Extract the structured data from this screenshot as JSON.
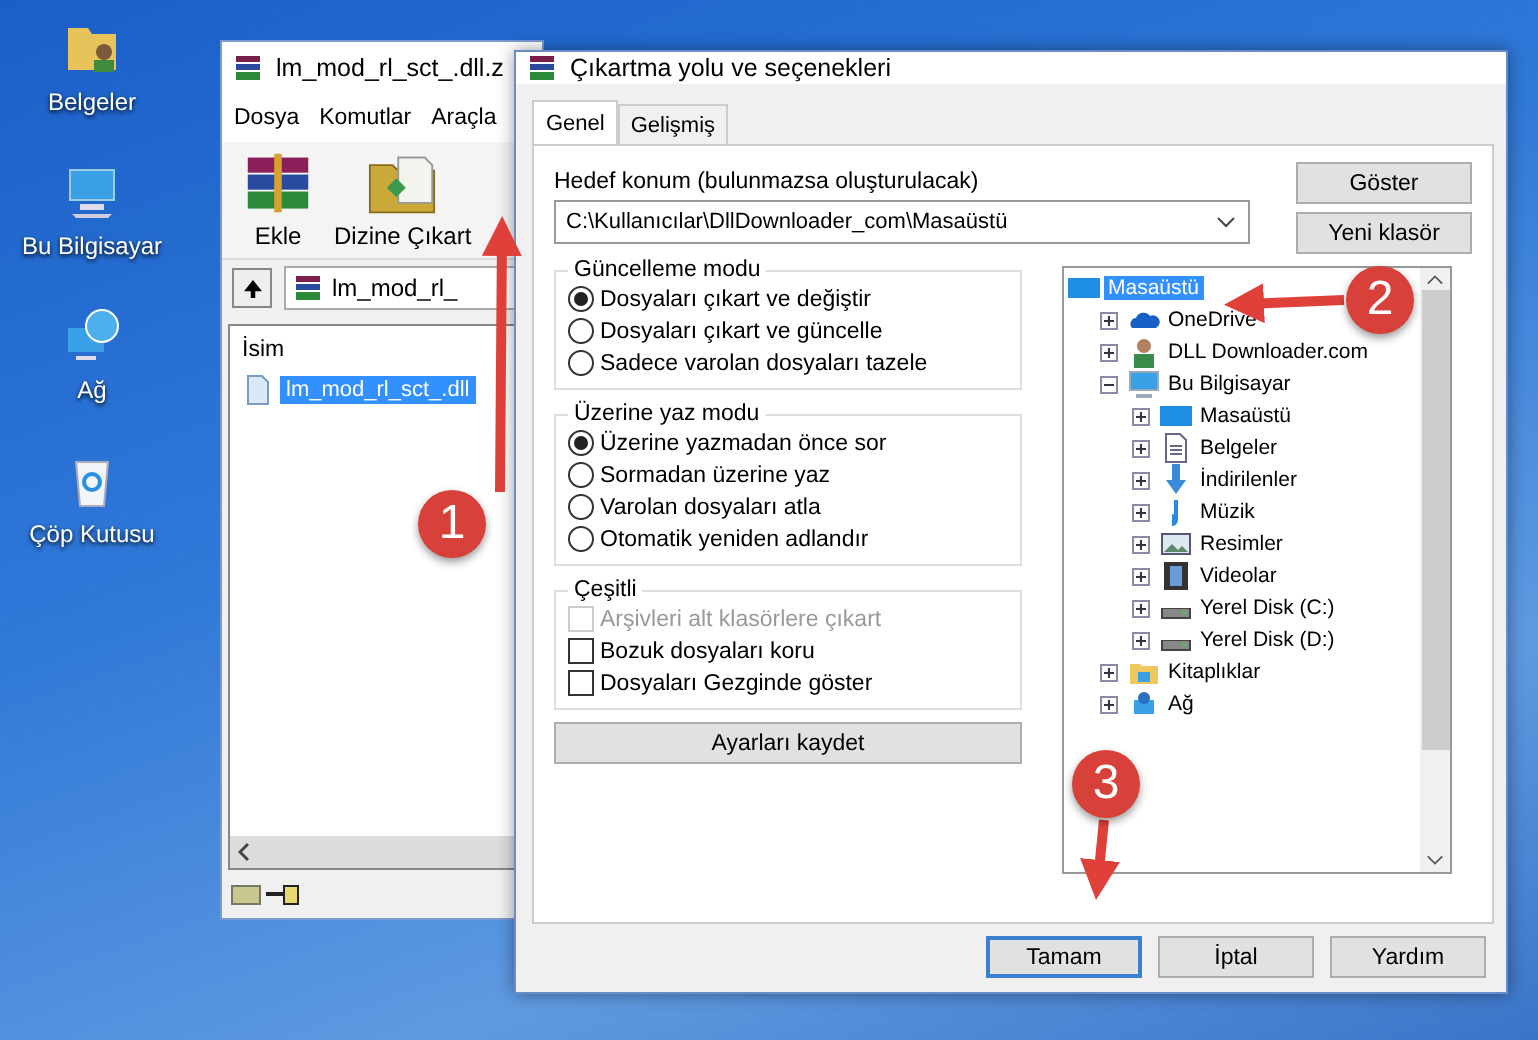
{
  "desktop_icons": [
    {
      "kind": "documents",
      "label": "Belgeler"
    },
    {
      "kind": "computer",
      "label": "Bu Bilgisayar"
    },
    {
      "kind": "network",
      "label": "Ağ"
    },
    {
      "kind": "recycle",
      "label": "Çöp Kutusu"
    }
  ],
  "archive_window": {
    "title": "lm_mod_rl_sct_.dll.z",
    "menu": [
      "Dosya",
      "Komutlar",
      "Araçla"
    ],
    "toolbar": [
      {
        "kind": "add",
        "label": "Ekle"
      },
      {
        "kind": "extract",
        "label": "Dizine Çıkart"
      }
    ],
    "address": "lm_mod_rl_",
    "column": "İsim",
    "files": [
      {
        "name": "lm_mod_rl_sct_.dll",
        "selected": true
      }
    ]
  },
  "dialog": {
    "title": "Çıkartma yolu ve seçenekleri",
    "tabs": [
      {
        "label": "Genel",
        "selected": true
      },
      {
        "label": "Gelişmiş",
        "selected": false
      }
    ],
    "destination_label": "Hedef konum (bulunmazsa oluşturulacak)",
    "destination_value": "C:\\Kullanıcılar\\DllDownloader_com\\Masaüstü",
    "side_buttons": [
      "Göster",
      "Yeni klasör"
    ],
    "update_mode": {
      "title": "Güncelleme modu",
      "options": [
        {
          "label": "Dosyaları çıkart ve değiştir",
          "selected": true
        },
        {
          "label": "Dosyaları çıkart ve güncelle",
          "selected": false
        },
        {
          "label": "Sadece varolan dosyaları tazele",
          "selected": false
        }
      ]
    },
    "overwrite_mode": {
      "title": "Üzerine yaz modu",
      "options": [
        {
          "label": "Üzerine yazmadan önce sor",
          "selected": true
        },
        {
          "label": "Sormadan üzerine yaz",
          "selected": false
        },
        {
          "label": "Varolan dosyaları atla",
          "selected": false
        },
        {
          "label": "Otomatik yeniden adlandır",
          "selected": false
        }
      ]
    },
    "misc": {
      "title": "Çeşitli",
      "options": [
        {
          "label": "Arşivleri alt klasörlere çıkart",
          "checked": false,
          "disabled": true
        },
        {
          "label": "Bozuk dosyaları koru",
          "checked": false,
          "disabled": false
        },
        {
          "label": "Dosyaları Gezginde göster",
          "checked": false,
          "disabled": false
        }
      ]
    },
    "save_button": "Ayarları kaydet",
    "tree": [
      {
        "kind": "desktop",
        "label": "Masaüstü",
        "selected": true,
        "children": [
          {
            "kind": "cloud",
            "label": "OneDrive",
            "selected": false,
            "expanded": false
          },
          {
            "kind": "user",
            "label": "DLL Downloader.com",
            "selected": false,
            "expanded": false
          },
          {
            "kind": "computer",
            "label": "Bu Bilgisayar",
            "selected": false,
            "expanded": true,
            "children": [
              {
                "kind": "desktop",
                "label": "Masaüstü",
                "selected": false,
                "expanded": false
              },
              {
                "kind": "document",
                "label": "Belgeler",
                "selected": false,
                "expanded": false
              },
              {
                "kind": "download",
                "label": "İndirilenler",
                "selected": false,
                "expanded": false
              },
              {
                "kind": "music",
                "label": "Müzik",
                "selected": false,
                "expanded": false
              },
              {
                "kind": "pictures",
                "label": "Resimler",
                "selected": false,
                "expanded": false
              },
              {
                "kind": "videos",
                "label": "Videolar",
                "selected": false,
                "expanded": false
              },
              {
                "kind": "drive",
                "label": "Yerel Disk (C:)",
                "selected": false,
                "expanded": false
              },
              {
                "kind": "drive",
                "label": "Yerel Disk (D:)",
                "selected": false,
                "expanded": false
              }
            ]
          },
          {
            "kind": "library",
            "label": "Kitaplıklar",
            "selected": false,
            "expanded": false
          },
          {
            "kind": "network",
            "label": "Ağ",
            "selected": false,
            "expanded": false
          }
        ]
      }
    ],
    "buttons": [
      {
        "label": "Tamam",
        "default": true
      },
      {
        "label": "İptal",
        "default": false
      },
      {
        "label": "Yardım",
        "default": false
      }
    ]
  },
  "annotations": [
    "1",
    "2",
    "3"
  ]
}
